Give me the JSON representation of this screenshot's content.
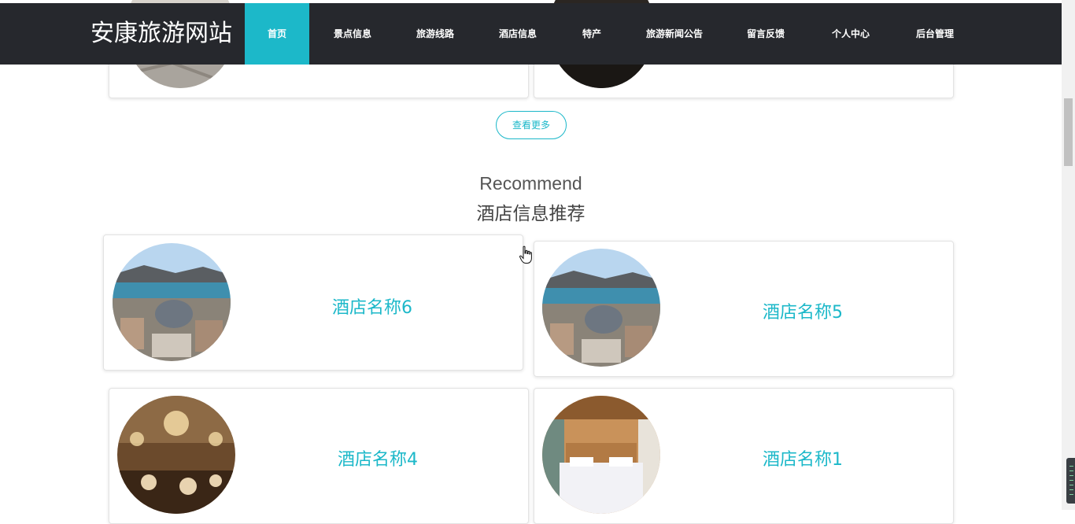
{
  "brand": {
    "title": "安康旅游网站"
  },
  "nav": {
    "items": [
      {
        "label": "首页",
        "active": true
      },
      {
        "label": "景点信息"
      },
      {
        "label": "旅游线路"
      },
      {
        "label": "酒店信息"
      },
      {
        "label": "特产"
      },
      {
        "label": "旅游新闻公告"
      },
      {
        "label": "留言反馈"
      },
      {
        "label": "个人中心"
      },
      {
        "label": "后台管理"
      }
    ]
  },
  "prev_section": {
    "more_label": "查看更多"
  },
  "hotel_section": {
    "title_en": "Recommend",
    "title_cn": "酒店信息推荐",
    "items": [
      {
        "name": "酒店名称6",
        "image": "lakeside-resort-photo"
      },
      {
        "name": "酒店名称5",
        "image": "lakeside-resort-photo"
      },
      {
        "name": "酒店名称4",
        "image": "banquet-hall-photo"
      },
      {
        "name": "酒店名称1",
        "image": "hotel-bedroom-photo"
      }
    ]
  },
  "colors": {
    "accent": "#1cb8c9",
    "nav_bg": "#26282d"
  }
}
